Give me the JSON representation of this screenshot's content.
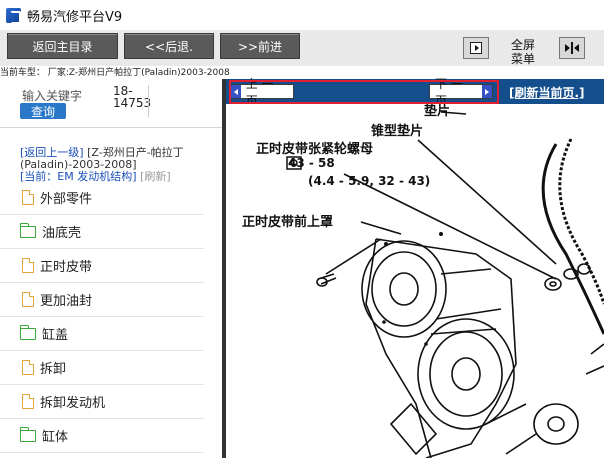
{
  "app": {
    "title": "畅易汽修平台V9"
  },
  "toolbar": {
    "home_label": "返回主目录",
    "back_label": "<<后退.",
    "forward_label": ">>前进",
    "fullscreen_label": "全屏\n菜单"
  },
  "vehicle": {
    "text": "当前车型： 厂家:Z-郑州日产帕拉丁(Paladin)2003-2008"
  },
  "search": {
    "label": "输入关键字",
    "value": "18-\n14753",
    "button": "查询"
  },
  "breadcrumb": {
    "back_link": "[返回上一级]",
    "back_path": "[Z-郑州日产-帕拉丁(Paladin)-2003-2008]",
    "current_link": "[当前：EM 发动机结构]",
    "refresh": "[刷新]"
  },
  "tree": [
    {
      "label": "外部零件",
      "icon": "document-icon"
    },
    {
      "label": "油底壳",
      "icon": "folder-icon"
    },
    {
      "label": "正时皮带",
      "icon": "document-icon"
    },
    {
      "label": "更加油封",
      "icon": "document-icon"
    },
    {
      "label": "缸盖",
      "icon": "folder-icon"
    },
    {
      "label": "拆卸",
      "icon": "document-icon"
    },
    {
      "label": "拆卸发动机",
      "icon": "document-icon"
    },
    {
      "label": "缸体",
      "icon": "folder-icon"
    }
  ],
  "viewer": {
    "prev_label": "上 一 页",
    "next_label": "下 一 页",
    "refresh_label": "[刷新当前页.]",
    "labels": {
      "gasket_partial": "垫片",
      "cone_washer": "锥型垫片",
      "tensioner_nut": "正时皮带张紧轮螺母",
      "torque1": "43 - 58",
      "torque2": "(4.4 - 5.9, 32 - 43)",
      "front_cover": "正时皮带前上罩"
    }
  },
  "colors": {
    "navbar": "#144e8c",
    "accent_red": "#e02030",
    "toolbar_btn": "#5a5a5a",
    "link": "#1a4fb8"
  }
}
